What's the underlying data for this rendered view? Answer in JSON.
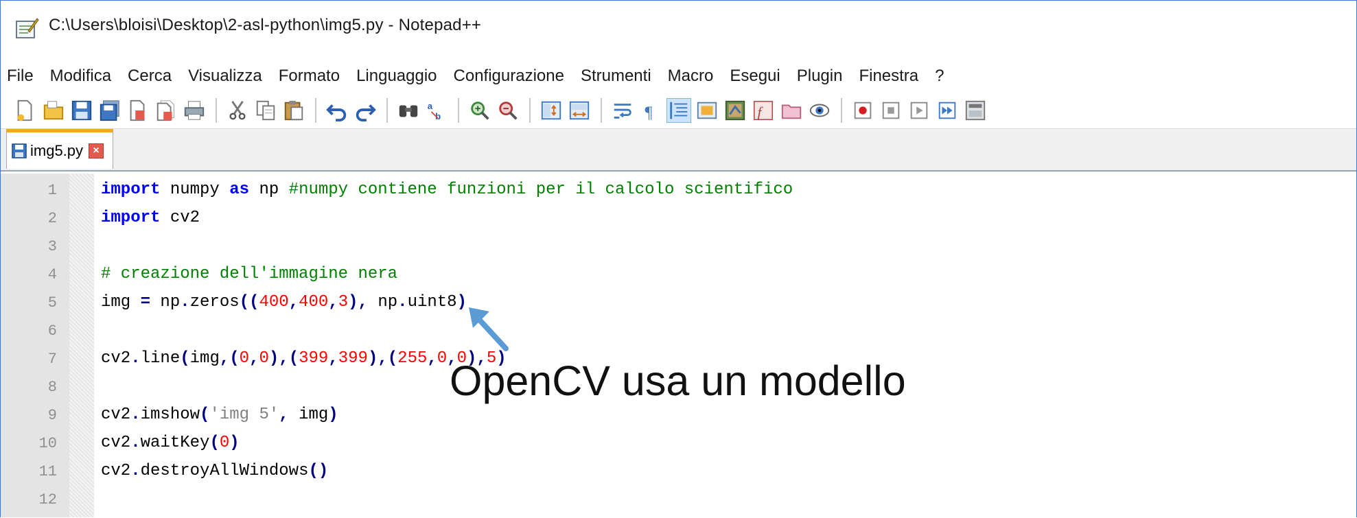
{
  "window": {
    "title": "C:\\Users\\bloisi\\Desktop\\2-asl-python\\img5.py - Notepad++",
    "accent": "#3a7bd5"
  },
  "menubar": {
    "items": [
      "File",
      "Modifica",
      "Cerca",
      "Visualizza",
      "Formato",
      "Linguaggio",
      "Configurazione",
      "Strumenti",
      "Macro",
      "Esegui",
      "Plugin",
      "Finestra",
      "?"
    ]
  },
  "toolbar": {
    "groups": [
      [
        "new-file-icon",
        "open-file-icon",
        "save-icon",
        "save-all-icon",
        "close-icon",
        "close-all-icon",
        "print-icon"
      ],
      [
        "cut-icon",
        "copy-icon",
        "paste-icon"
      ],
      [
        "undo-icon",
        "redo-icon"
      ],
      [
        "find-icon",
        "replace-icon"
      ],
      [
        "zoom-in-icon",
        "zoom-out-icon"
      ],
      [
        "sync-vertical-icon",
        "sync-horizontal-icon"
      ],
      [
        "word-wrap-icon",
        "show-all-chars-icon",
        "indent-guide-icon",
        "user-language-icon",
        "document-map-icon",
        "function-list-icon",
        "folder-workspace-icon",
        "monitoring-icon"
      ],
      [
        "record-macro-icon",
        "stop-macro-icon",
        "play-macro-icon",
        "run-macro-multiple-icon",
        "save-macro-icon"
      ]
    ]
  },
  "tabs": [
    {
      "label": "img5.py",
      "active": true
    }
  ],
  "editor": {
    "line_numbers": [
      "1",
      "2",
      "3",
      "4",
      "5",
      "6",
      "7",
      "8",
      "9",
      "10",
      "11",
      "12"
    ],
    "lines": [
      [
        {
          "t": "import",
          "c": "kw"
        },
        {
          "t": " numpy ",
          "c": ""
        },
        {
          "t": "as",
          "c": "kw"
        },
        {
          "t": " np ",
          "c": ""
        },
        {
          "t": "#numpy contiene funzioni per il calcolo scientifico",
          "c": "cm"
        }
      ],
      [
        {
          "t": "import",
          "c": "kw"
        },
        {
          "t": " cv2",
          "c": ""
        }
      ],
      [],
      [
        {
          "t": "# creazione dell'immagine nera",
          "c": "cm"
        }
      ],
      [
        {
          "t": "img ",
          "c": ""
        },
        {
          "t": "=",
          "c": "op"
        },
        {
          "t": " np",
          "c": ""
        },
        {
          "t": ".",
          "c": "op"
        },
        {
          "t": "zeros",
          "c": ""
        },
        {
          "t": "((",
          "c": "op"
        },
        {
          "t": "400",
          "c": "num"
        },
        {
          "t": ",",
          "c": "op"
        },
        {
          "t": "400",
          "c": "num"
        },
        {
          "t": ",",
          "c": "op"
        },
        {
          "t": "3",
          "c": "num"
        },
        {
          "t": "),",
          "c": "op"
        },
        {
          "t": " np",
          "c": ""
        },
        {
          "t": ".",
          "c": "op"
        },
        {
          "t": "uint8",
          "c": ""
        },
        {
          "t": ")",
          "c": "op"
        }
      ],
      [],
      [
        {
          "t": "cv2",
          "c": ""
        },
        {
          "t": ".",
          "c": "op"
        },
        {
          "t": "line",
          "c": ""
        },
        {
          "t": "(",
          "c": "op"
        },
        {
          "t": "img",
          "c": ""
        },
        {
          "t": ",(",
          "c": "op"
        },
        {
          "t": "0",
          "c": "num"
        },
        {
          "t": ",",
          "c": "op"
        },
        {
          "t": "0",
          "c": "num"
        },
        {
          "t": "),(",
          "c": "op"
        },
        {
          "t": "399",
          "c": "num"
        },
        {
          "t": ",",
          "c": "op"
        },
        {
          "t": "399",
          "c": "num"
        },
        {
          "t": "),(",
          "c": "op"
        },
        {
          "t": "255",
          "c": "num"
        },
        {
          "t": ",",
          "c": "op"
        },
        {
          "t": "0",
          "c": "num"
        },
        {
          "t": ",",
          "c": "op"
        },
        {
          "t": "0",
          "c": "num"
        },
        {
          "t": "),",
          "c": "op"
        },
        {
          "t": "5",
          "c": "num"
        },
        {
          "t": ")",
          "c": "op"
        }
      ],
      [],
      [
        {
          "t": "cv2",
          "c": ""
        },
        {
          "t": ".",
          "c": "op"
        },
        {
          "t": "imshow",
          "c": ""
        },
        {
          "t": "(",
          "c": "op"
        },
        {
          "t": "'img 5'",
          "c": "str"
        },
        {
          "t": ",",
          "c": "op"
        },
        {
          "t": " img",
          "c": ""
        },
        {
          "t": ")",
          "c": "op"
        }
      ],
      [
        {
          "t": "cv2",
          "c": ""
        },
        {
          "t": ".",
          "c": "op"
        },
        {
          "t": "waitKey",
          "c": ""
        },
        {
          "t": "(",
          "c": "op"
        },
        {
          "t": "0",
          "c": "num"
        },
        {
          "t": ")",
          "c": "op"
        }
      ],
      [
        {
          "t": "cv2",
          "c": ""
        },
        {
          "t": ".",
          "c": "op"
        },
        {
          "t": "destroyAllWindows",
          "c": ""
        },
        {
          "t": "()",
          "c": "op"
        }
      ],
      []
    ]
  },
  "annotation": {
    "text": "OpenCV usa un modello",
    "arrow_color": "#5b9bd5"
  }
}
